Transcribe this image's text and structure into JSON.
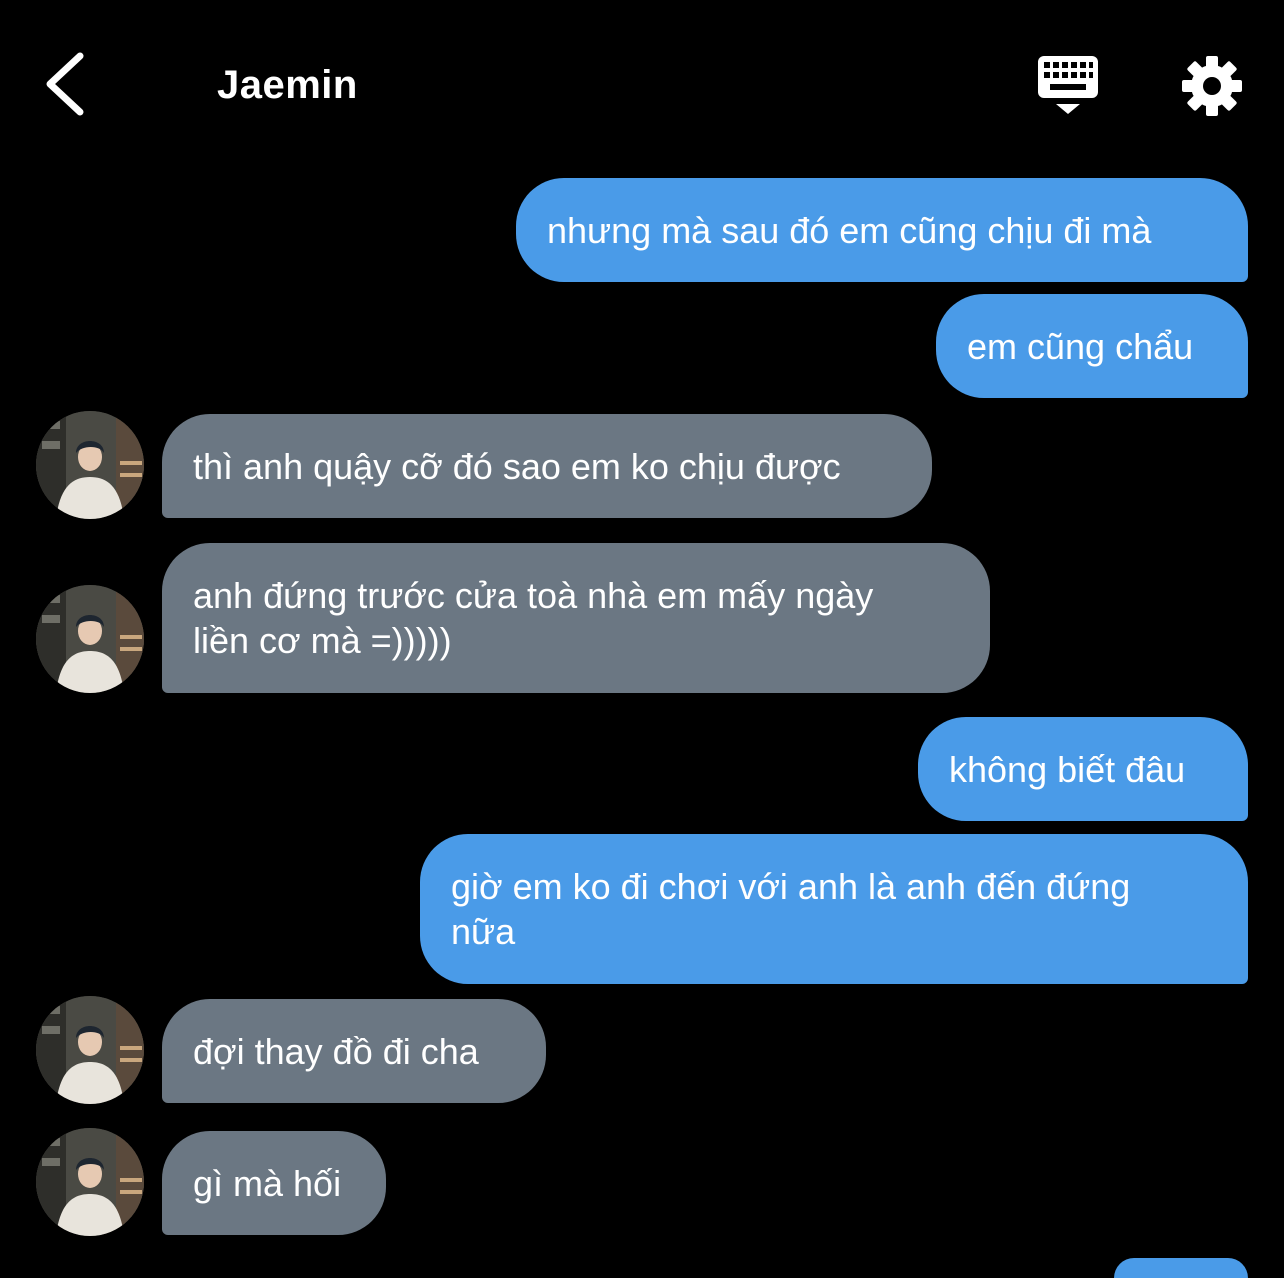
{
  "header": {
    "title": "Jaemin",
    "back_icon": "chevron-left-icon",
    "keyboard_icon": "keyboard-hide-icon",
    "settings_icon": "gear-icon"
  },
  "colors": {
    "background": "#000000",
    "sent_bubble": "#4a9be8",
    "received_bubble": "#6b7783",
    "text": "#ffffff"
  },
  "messages": [
    {
      "from": "me",
      "text": "nhưng mà sau đó em cũng chịu đi mà"
    },
    {
      "from": "me",
      "text": "em cũng chẩu"
    },
    {
      "from": "Jaemin",
      "text": "thì anh quậy cỡ đó sao em ko chịu được"
    },
    {
      "from": "Jaemin",
      "line1": "anh đứng trước cửa toà nhà em mấy ngày",
      "line2": "liền cơ mà =)))))"
    },
    {
      "from": "me",
      "text": "không biết đâu"
    },
    {
      "from": "me",
      "line1": "giờ em ko đi chơi với anh là anh đến đứng",
      "line2": "nữa"
    },
    {
      "from": "Jaemin",
      "text": "đợi thay đồ đi cha"
    },
    {
      "from": "Jaemin",
      "text": "gì mà hối"
    }
  ]
}
